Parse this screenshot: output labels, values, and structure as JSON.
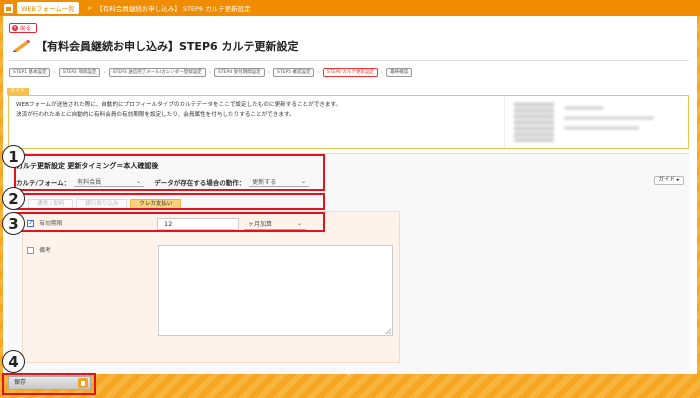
{
  "topbar": {
    "crumb1": "WEBフォーム一覧",
    "sep": ">",
    "crumb2": "【有料会員継続お申し込み】 STEP6 カルテ更新設定"
  },
  "back_button": {
    "icon": "close-icon",
    "label": "戻る"
  },
  "page_title": "【有料会員継続お申し込み】STEP6 カルテ更新設定",
  "steps": [
    {
      "label": "STEP1 基本設定",
      "state": "done"
    },
    {
      "label": "STEP2 項目設定",
      "state": "done"
    },
    {
      "label": "STEP3 送信完了メール/カレンダー登録設定",
      "state": "done"
    },
    {
      "label": "STEP4 受付期間設定",
      "state": "done"
    },
    {
      "label": "STEP5 確認設定",
      "state": "done"
    },
    {
      "label": "STEP6 カルテ更新設定",
      "state": "current"
    },
    {
      "label": "最終確認",
      "state": "done"
    }
  ],
  "guide": {
    "tab": "ガイド",
    "line1": "WEBフォームが送信された際に、自動的にプロフィールタイプのカルテデータをここで設定したものに更新することができます。",
    "line2": "決済が行われたあとに自動的に有料会員の有効期限を設定したり、会員属性を付与したりすることができます。"
  },
  "settings": {
    "heading": "カルテ更新設定 更新タイミング＝本人確認後",
    "form_label": "カルテ/フォーム：",
    "form_value": "有料会員",
    "exists_label": "データが存在する場合の動作：",
    "exists_value": "更新する",
    "guide_button": "ガイド ▸"
  },
  "tabs": [
    "通常 / 即時",
    "銀行振り込み",
    "クレカ支払い"
  ],
  "active_tab": 2,
  "fields": {
    "validity": {
      "label": "有効期限",
      "checked": true,
      "value": "12",
      "unit": "ヶ月加算"
    },
    "note": {
      "label": "備考",
      "checked": false,
      "value": ""
    }
  },
  "save_button": "保存",
  "annotations": [
    "1",
    "2",
    "3",
    "4"
  ],
  "colors": {
    "accent": "#f08c00",
    "annotation": "#e0141e",
    "active_tab": "#f6d27a"
  }
}
